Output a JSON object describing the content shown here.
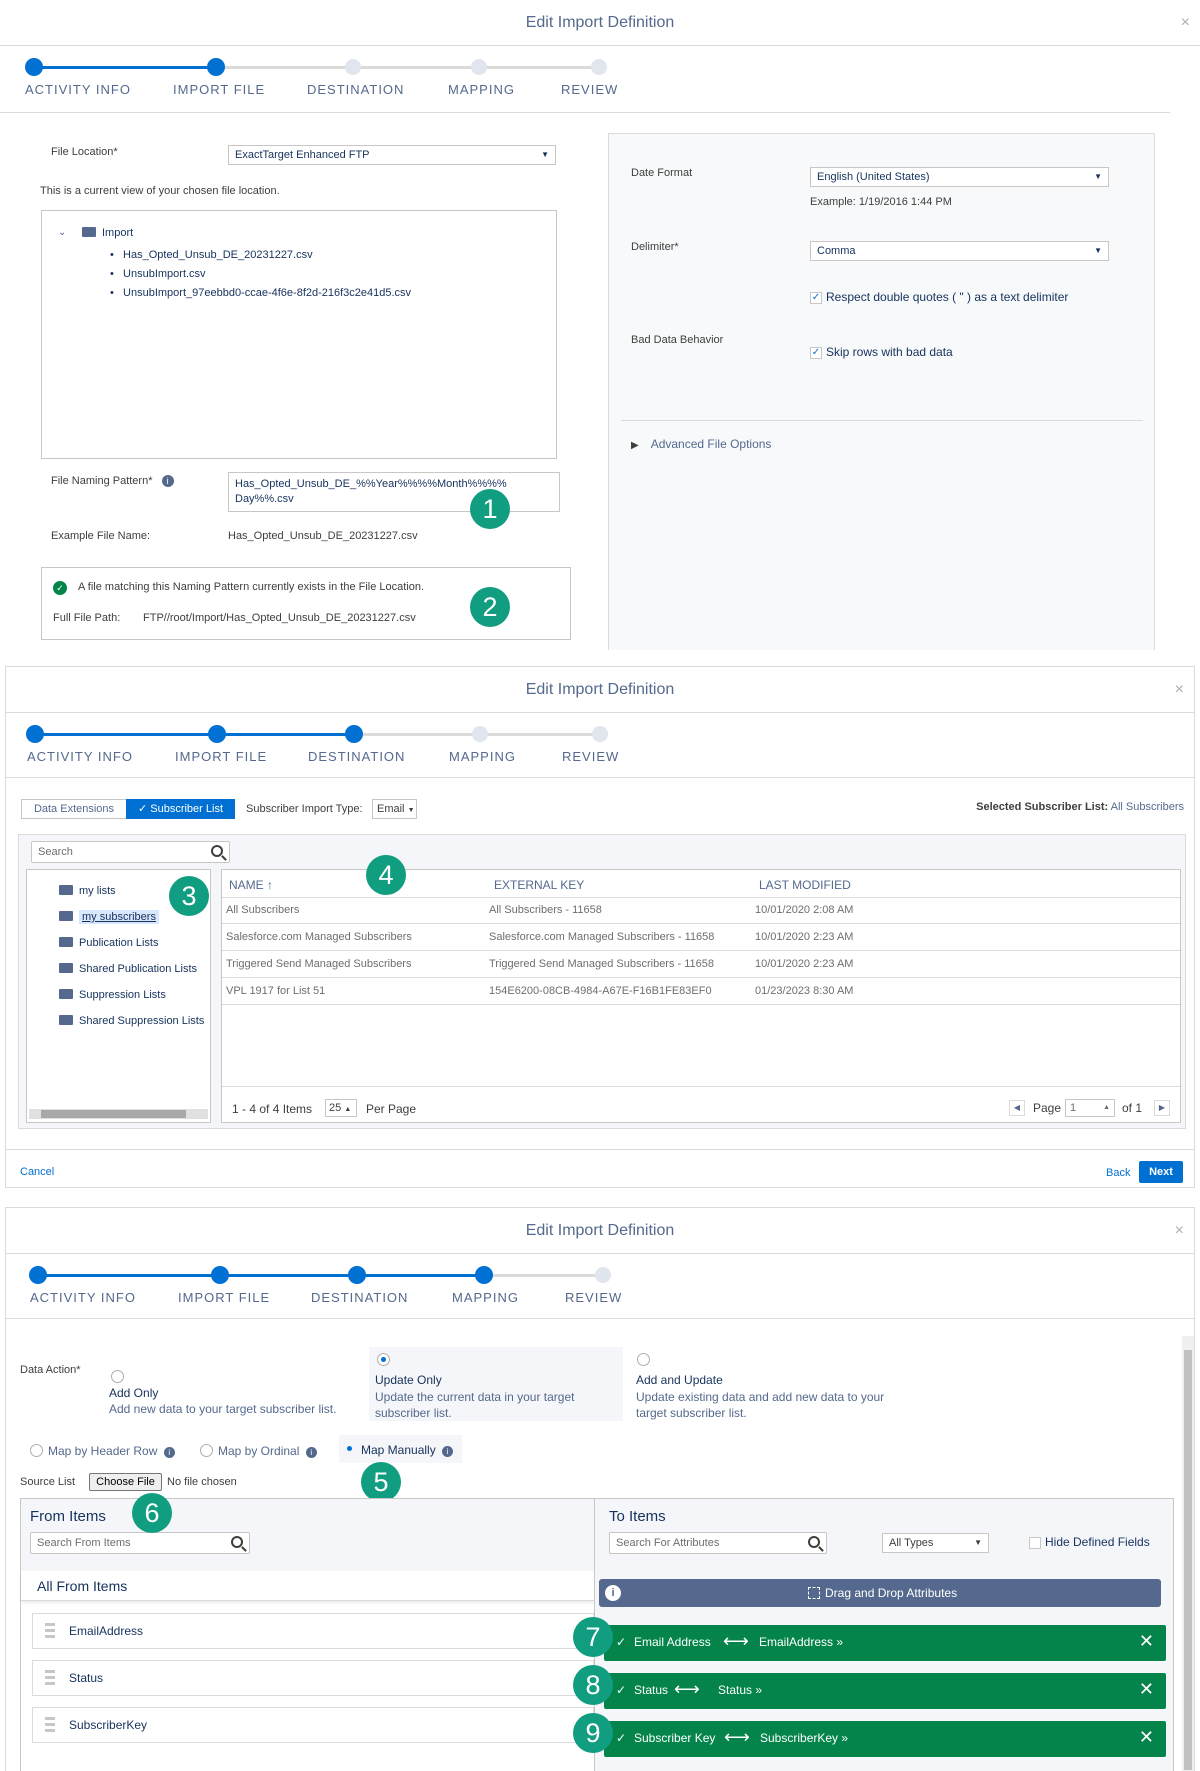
{
  "dialog_title": "Edit Import Definition",
  "close_glyph": "×",
  "steps": [
    "ACTIVITY INFO",
    "IMPORT FILE",
    "DESTINATION",
    "MAPPING",
    "REVIEW"
  ],
  "import_file": {
    "file_location_label": "File Location*",
    "file_location_value": "ExactTarget Enhanced FTP",
    "current_view_text": "This is a current view of your chosen file location.",
    "folder_name": "Import",
    "files": [
      "Has_Opted_Unsub_DE_20231227.csv",
      "UnsubImport.csv",
      "UnsubImport_97eebbd0-ccae-4f6e-8f2d-216f3c2e41d5.csv"
    ],
    "naming_pattern_label": "File Naming Pattern*",
    "naming_pattern_value_line1": "Has_Opted_Unsub_DE_%%Year%%%%Month%%%%",
    "naming_pattern_value_line2": "Day%%.csv",
    "example_label": "Example File Name:",
    "example_value": "Has_Opted_Unsub_DE_20231227.csv",
    "match_text": "A file matching this Naming Pattern currently exists in the File Location.",
    "full_path_label": "Full File Path:",
    "full_path_value": "FTP//root/Import/Has_Opted_Unsub_DE_20231227.csv",
    "date_format_label": "Date Format",
    "date_format_value": "English (United States)",
    "date_example": "Example: 1/19/2016 1:44 PM",
    "delimiter_label": "Delimiter*",
    "delimiter_value": "Comma",
    "respect_quotes": "Respect double quotes ( \" ) as a text delimiter",
    "bad_data_label": "Bad Data Behavior",
    "skip_rows": "Skip rows with bad data",
    "advanced": "Advanced File Options",
    "badge1": "1",
    "badge2": "2"
  },
  "destination": {
    "tab_data_ext": "Data Extensions",
    "tab_sub_list": "Subscriber List",
    "import_type_label": "Subscriber Import Type:",
    "import_type_value": "Email",
    "selected_label": "Selected Subscriber List:",
    "selected_value": "All Subscribers",
    "search_placeholder": "Search",
    "tree": [
      "my lists",
      "my subscribers",
      "Publication Lists",
      "Shared Publication Lists",
      "Suppression Lists",
      "Shared Suppression Lists"
    ],
    "columns": [
      "NAME ↑",
      "EXTERNAL KEY",
      "LAST MODIFIED"
    ],
    "rows": [
      [
        "All Subscribers",
        "All Subscribers - 11658",
        "10/01/2020 2:08 AM"
      ],
      [
        "Salesforce.com Managed Subscribers",
        "Salesforce.com Managed Subscribers - 11658",
        "10/01/2020 2:23 AM"
      ],
      [
        "Triggered Send Managed Subscribers",
        "Triggered Send Managed Subscribers - 11658",
        "10/01/2020 2:23 AM"
      ],
      [
        "VPL 1917 for List 51",
        "154E6200-08CB-4984-A67E-F16B1FE83EF0",
        "01/23/2023 8:30 AM"
      ]
    ],
    "items_count": "1 - 4 of 4 Items",
    "per_page_value": "25",
    "per_page_label": "Per Page",
    "page_label": "Page",
    "page_value": "1",
    "page_of": "of 1",
    "cancel": "Cancel",
    "back": "Back",
    "next": "Next",
    "badge3": "3",
    "badge4": "4"
  },
  "mapping": {
    "data_action_label": "Data Action*",
    "options": [
      {
        "title": "Add Only",
        "desc": "Add new data to your target subscriber list."
      },
      {
        "title": "Update Only",
        "desc": "Update the current data in your target subscriber list."
      },
      {
        "title": "Add and Update",
        "desc": "Update existing data and add new data to your target subscriber list."
      }
    ],
    "map_header": "Map by Header Row",
    "map_ordinal": "Map by Ordinal",
    "map_manual": "Map Manually",
    "source_list_label": "Source List",
    "choose_file": "Choose File",
    "no_file": "No file chosen",
    "from_items_title": "From Items",
    "from_search_placeholder": "Search From Items",
    "all_from_items": "All From Items",
    "from_items": [
      "EmailAddress",
      "Status",
      "SubscriberKey"
    ],
    "to_items_title": "To Items",
    "to_search_placeholder": "Search For Attributes",
    "types_value": "All Types",
    "hide_defined": "Hide Defined Fields",
    "drag_drop": "Drag and Drop Attributes",
    "mappings": [
      {
        "to": "Email Address",
        "from": "EmailAddress »"
      },
      {
        "to": "Status",
        "from": "Status »"
      },
      {
        "to": "Subscriber Key",
        "from": "SubscriberKey »"
      }
    ],
    "badge5": "5",
    "badge6": "6",
    "badge7": "7",
    "badge8": "8",
    "badge9": "9"
  }
}
